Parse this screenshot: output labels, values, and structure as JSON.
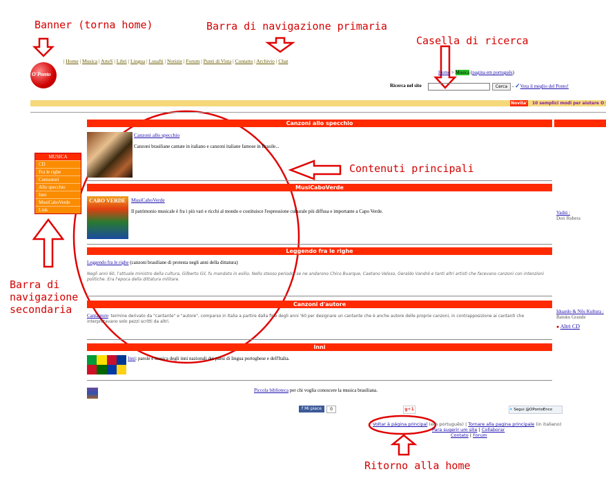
{
  "annotations": {
    "banner": "Banner (torna home)",
    "primary_nav": "Barra di navigazione primaria",
    "search": "Casella di ricerca",
    "main": "Contenuti principali",
    "secondary_nav": [
      "Barra di",
      "navigazione",
      "secondaria"
    ],
    "home": "Ritorno alla home"
  },
  "logo": {
    "text": "O'Ponto"
  },
  "primary_nav": [
    "Home",
    "Musica",
    "ArteS",
    "Libri",
    "Lingua",
    "Lusafti",
    "Notizie",
    "Forum",
    "Punti di Vista",
    "Contatto",
    "Archivio",
    "Chat"
  ],
  "breadcrumb": {
    "home": "Home",
    "sep": ">",
    "current": "Musica",
    "portuguese_link": "pagina em português"
  },
  "search": {
    "label": "Ricerca nel sito",
    "button": "Cerca",
    "vote": "Vota il meglio del Ponto!"
  },
  "ticker": {
    "badge": "Novita'",
    "text": "10 semplici modi per aiutare O P"
  },
  "secondary_nav": {
    "title": "MUSICA",
    "items": [
      "CD",
      "Fra le righe",
      "Cantautori",
      "Allo specchio",
      "Inni",
      "MusiCaboVerde",
      "Link"
    ]
  },
  "sections": {
    "s1": {
      "title": "Canzoni allo specchio",
      "link": "Canzoni allo specchio",
      "text": "Canzoni brasiliane cantate in italiano e canzoni italiane famose in Brasile..."
    },
    "s2": {
      "title": "MusiCaboVerde",
      "link": "MusiCaboVerde",
      "text": "Il patrimonio musicale è fra i più vari e ricchi al mondo e costituisce l'espressione culturale più diffusa e importante a Capo Verde.",
      "cover": "CABO VERDE"
    },
    "s3": {
      "title": "Leggendo fra le righe",
      "link": "Leggendo fra le righe",
      "text": "(canzoni brasiliane di protesta negli anni della dittatura)",
      "desc": "Negli anni 60, l'attuale ministro della cultura, Gilberto Gil, fu mandato in esilio. Nello stesso periodo, se ne andarono Chico Buarque, Caetano Veloso, Geraldo Vandré e tanti altri artisti che facevano canzoni con intenzioni politiche. Era l'epoca della dittatura militare."
    },
    "s4": {
      "title": "Canzoni d'autore",
      "link": "Cantautore",
      "text": ": termine derivato da \"cantante\" e \"autore\", comparso in Italia a partire dalla fine degli anni '60 per designare un cantante che è anche autore delle proprie canzoni, in contrapposizione ai cantanti che interpretavano solo pezzi scritti da altri."
    },
    "s5": {
      "title": "Inni",
      "link": "Inni",
      "text": ": parole e musica degli inni nazionali dei paesi di lingua portoghese e dell'Italia."
    }
  },
  "library": {
    "link": "Piccola biblioteca",
    "text": "per chi voglia conoscere la musica brasiliana."
  },
  "social": {
    "like": "Mi piace",
    "like_count": "0",
    "gplus": "g+1",
    "twitter": "Segui @OPontoEnco"
  },
  "right_col": {
    "item1_link": "Vadiú :",
    "item1_text": "Dori Rubera",
    "item2_link": "Iduardo & Nôs Kultura :",
    "item2_text": "Batuku Grande",
    "more_cd": "Altri CD"
  },
  "footer": {
    "link1": "Voltar à página principal",
    "text1": "(em português)",
    "sep": "|",
    "link2": "Tornare alla pagina principale",
    "text2": "(in italiano)",
    "link3": "Para sugerir um site",
    "link4": "Collaborar",
    "link5": "Contato",
    "link6": "Forum"
  }
}
